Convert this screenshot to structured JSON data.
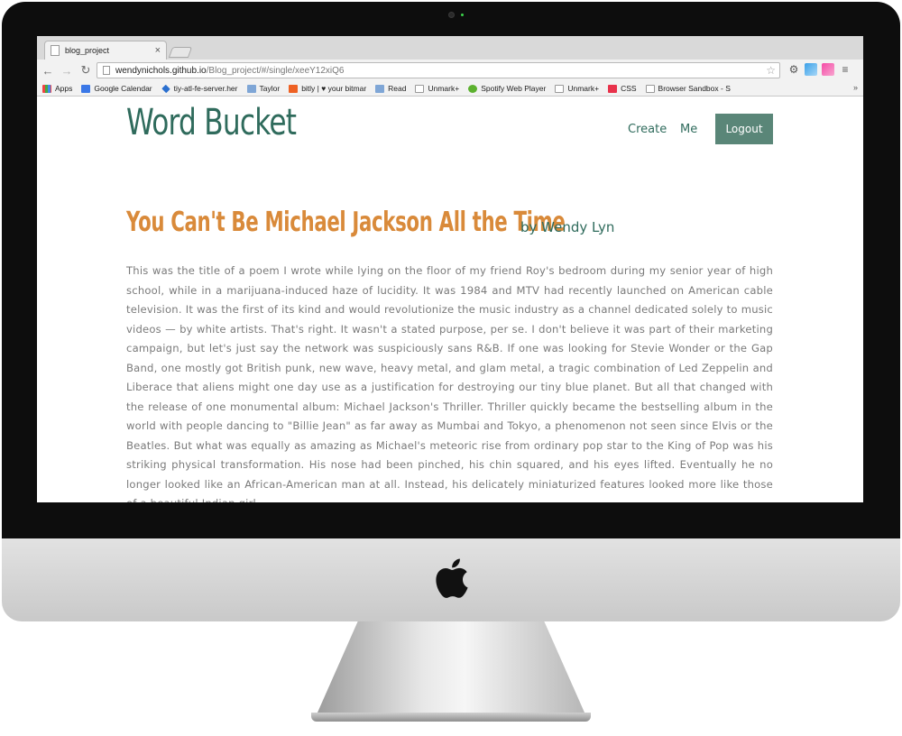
{
  "browser": {
    "tab_title": "blog_project",
    "url_host": "wendynichols.github.io",
    "url_path": "/Blog_project/#/single/xeeY12xiQ6",
    "bookmarks": [
      "Apps",
      "Google Calendar",
      "tiy-atl-fe-server.her",
      "Taylor",
      "bitly | ♥ your bitmar",
      "Read",
      "Unmark+",
      "Spotify Web Player",
      "Unmark+",
      "CSS",
      "Browser Sandbox - S"
    ]
  },
  "site": {
    "logo": "Word Bucket",
    "nav": {
      "create": "Create",
      "me": "Me",
      "logout": "Logout"
    }
  },
  "post": {
    "title": "You Can't Be Michael Jackson All the Time",
    "author": "by Wendy Lyn",
    "body": "This was the title of a poem I wrote while lying on the floor of my friend Roy's bedroom during my senior year of high school, while in a marijuana-induced haze of lucidity. It was 1984 and MTV had recently launched on American cable television. It was the first of its kind and would revolutionize the music industry as a channel dedicated solely to music videos — by white artists. That's right. It wasn't a stated purpose, per se. I don't believe it was part of their marketing campaign, but let's just say the network was suspiciously sans R&B. If one was looking for Stevie Wonder or the Gap Band, one mostly got British punk, new wave, heavy metal, and glam metal, a tragic combination of Led Zeppelin and Liberace that aliens might one day use as a justification for destroying our tiny blue planet. But all that changed with the release of one monumental album: Michael Jackson's Thriller. Thriller quickly became the bestselling album in the world with people dancing to \"Billie Jean\" as far away as Mumbai and Tokyo, a phenomenon not seen since Elvis or the Beatles. But what was equally as amazing as Michael's meteoric rise from ordinary pop star to the King of Pop was his striking physical transformation. His nose had been pinched, his chin squared, and his eyes lifted. Eventually he no longer looked like an African-American man at all. Instead, his delicately miniaturized features looked more like those of a beautiful Indian girl."
  },
  "colors": {
    "brand_green": "#2f6b5c",
    "title_orange": "#d98a3a",
    "button_green": "#5a8678"
  }
}
